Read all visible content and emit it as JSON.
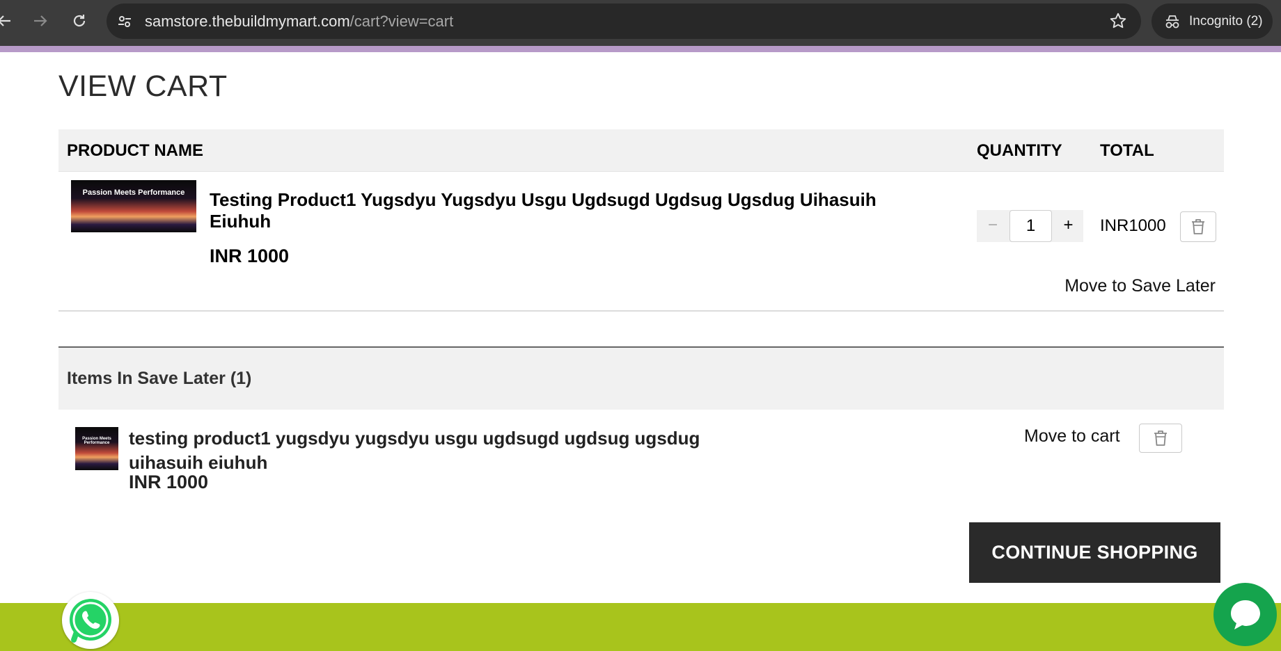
{
  "browser": {
    "url_main": "samstore.thebuildmymart.com",
    "url_rest": "/cart?view=cart",
    "incognito_label": "Incognito (2)",
    "back_icon": "arrow-left-icon",
    "forward_icon": "arrow-right-icon",
    "reload_icon": "reload-icon",
    "bookmark_icon": "star-icon"
  },
  "page": {
    "title": "VIEW CART",
    "accent_color": "#b79ac8",
    "footer_color": "#a8c41c"
  },
  "cart": {
    "headers": {
      "product_name": "PRODUCT NAME",
      "quantity": "QUANTITY",
      "total": "TOTAL"
    },
    "items": [
      {
        "thumb_text": "Passion Meets Performance",
        "name": "Testing Product1 Yugsdyu Yugsdyu Usgu Ugdsugd Ugdsug Ugsdug Uihasuih Eiuhuh",
        "price": "INR 1000",
        "quantity": "1",
        "minus": "−",
        "plus": "+",
        "total": "INR1000",
        "save_later": "Move to Save Later"
      }
    ]
  },
  "saved": {
    "heading": "Items In Save Later (1)",
    "items": [
      {
        "thumb_text": "Passion Meets Performance",
        "name": "testing product1 yugsdyu yugsdyu usgu ugdsugd ugdsug ugsdug uihasuih eiuhuh",
        "price": "INR 1000",
        "move_to_cart": "Move to cart"
      }
    ]
  },
  "actions": {
    "continue_shopping": "CONTINUE SHOPPING"
  }
}
